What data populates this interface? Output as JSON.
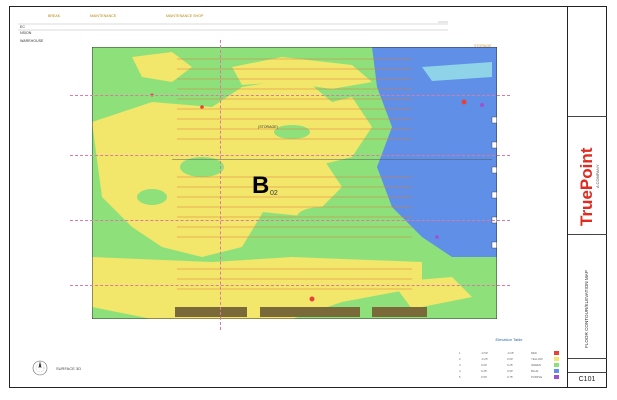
{
  "top_labels": {
    "l1": "BREAK",
    "l2": "MAINTENANCE",
    "l3": "MAINTENANCE SHOP",
    "l4": "EC",
    "l5": "NSION",
    "l6": "WAREHOUSE",
    "l7": "STORAGE"
  },
  "plan": {
    "building_letter": "B",
    "building_sub": "02",
    "label_storage": "(STORAGE)"
  },
  "legend": {
    "title": "Elevation Table",
    "rows": [
      {
        "col1": "1",
        "col2": "-0.50'",
        "col3": "-0.25'",
        "col4": "RED",
        "color": "#e8403a"
      },
      {
        "col1": "2",
        "col2": "-0.25'",
        "col3": "0.00'",
        "col4": "YELLOW",
        "color": "#f2e66b"
      },
      {
        "col1": "3",
        "col2": "0.00'",
        "col3": "0.25'",
        "col4": "GREEN",
        "color": "#8ee07a"
      },
      {
        "col1": "4",
        "col2": "0.25'",
        "col3": "0.50'",
        "col4": "BLUE",
        "color": "#5f8fe6"
      },
      {
        "col1": "5",
        "col2": "0.50'",
        "col3": "0.75'",
        "col4": "PURPLE",
        "color": "#a14fd6"
      }
    ]
  },
  "titleblock": {
    "brand_main": "TruePoint",
    "brand_sub": "A COMPANY",
    "sheet_title": "FLOOR CONTOUR/ELEVATION MAP",
    "sheet_number": "C101"
  },
  "compass_label": "SURFACE 3D",
  "colors": {
    "green": "#8ee07a",
    "yellow": "#f2e66b",
    "blue": "#5f8fe6",
    "red": "#e8403a",
    "purple": "#a14fd6",
    "brand_red": "#e02b20"
  }
}
